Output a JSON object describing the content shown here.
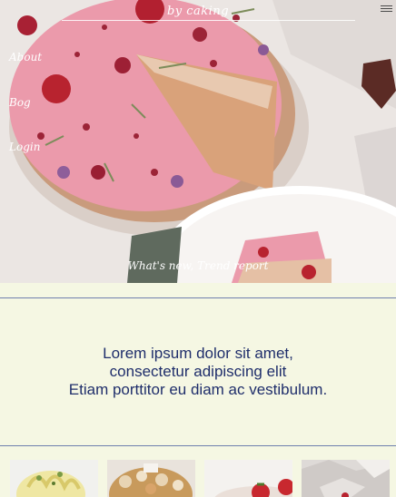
{
  "header": {
    "brand": "by caking",
    "menu_icon": "hamburger-menu-icon"
  },
  "nav": {
    "about": "About",
    "blog": "Bog",
    "login": "Login"
  },
  "hero": {
    "footer_link": "What's new, Trend report"
  },
  "main": {
    "line1": "Lorem ipsum dolor sit amet,",
    "line2": "consectetur adipiscing elit",
    "line3": "Etiam porttitor eu diam ac vestibulum."
  },
  "colors": {
    "background": "#f5f7e3",
    "text_navy": "#1f2e6b",
    "rule": "#6f7fae",
    "cake_pink": "#e88fa0"
  }
}
